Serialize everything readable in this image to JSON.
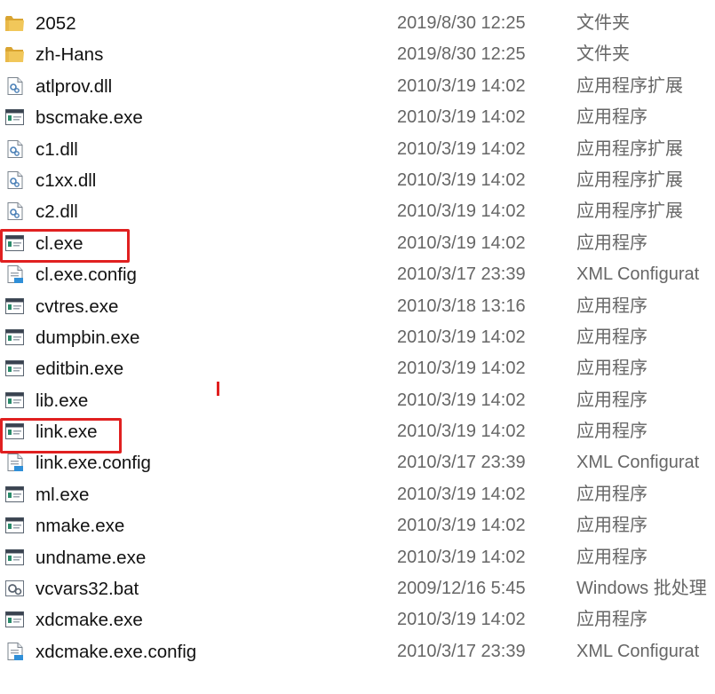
{
  "files": [
    {
      "name": "2052",
      "date": "2019/8/30 12:25",
      "type": "文件夹",
      "icon": "folder-icon"
    },
    {
      "name": "zh-Hans",
      "date": "2019/8/30 12:25",
      "type": "文件夹",
      "icon": "folder-icon"
    },
    {
      "name": "atlprov.dll",
      "date": "2010/3/19 14:02",
      "type": "应用程序扩展",
      "icon": "dll-icon"
    },
    {
      "name": "bscmake.exe",
      "date": "2010/3/19 14:02",
      "type": "应用程序",
      "icon": "exe-icon"
    },
    {
      "name": "c1.dll",
      "date": "2010/3/19 14:02",
      "type": "应用程序扩展",
      "icon": "dll-icon"
    },
    {
      "name": "c1xx.dll",
      "date": "2010/3/19 14:02",
      "type": "应用程序扩展",
      "icon": "dll-icon"
    },
    {
      "name": "c2.dll",
      "date": "2010/3/19 14:02",
      "type": "应用程序扩展",
      "icon": "dll-icon"
    },
    {
      "name": "cl.exe",
      "date": "2010/3/19 14:02",
      "type": "应用程序",
      "icon": "exe-icon",
      "highlighted": true
    },
    {
      "name": "cl.exe.config",
      "date": "2010/3/17 23:39",
      "type": "XML Configurat",
      "icon": "config-icon"
    },
    {
      "name": "cvtres.exe",
      "date": "2010/3/18 13:16",
      "type": "应用程序",
      "icon": "exe-icon"
    },
    {
      "name": "dumpbin.exe",
      "date": "2010/3/19 14:02",
      "type": "应用程序",
      "icon": "exe-icon"
    },
    {
      "name": "editbin.exe",
      "date": "2010/3/19 14:02",
      "type": "应用程序",
      "icon": "exe-icon"
    },
    {
      "name": "lib.exe",
      "date": "2010/3/19 14:02",
      "type": "应用程序",
      "icon": "exe-icon"
    },
    {
      "name": "link.exe",
      "date": "2010/3/19 14:02",
      "type": "应用程序",
      "icon": "exe-icon",
      "highlighted": true
    },
    {
      "name": "link.exe.config",
      "date": "2010/3/17 23:39",
      "type": "XML Configurat",
      "icon": "config-icon"
    },
    {
      "name": "ml.exe",
      "date": "2010/3/19 14:02",
      "type": "应用程序",
      "icon": "exe-icon"
    },
    {
      "name": "nmake.exe",
      "date": "2010/3/19 14:02",
      "type": "应用程序",
      "icon": "exe-icon"
    },
    {
      "name": "undname.exe",
      "date": "2010/3/19 14:02",
      "type": "应用程序",
      "icon": "exe-icon"
    },
    {
      "name": "vcvars32.bat",
      "date": "2009/12/16 5:45",
      "type": "Windows 批处理",
      "icon": "bat-icon"
    },
    {
      "name": "xdcmake.exe",
      "date": "2010/3/19 14:02",
      "type": "应用程序",
      "icon": "exe-icon"
    },
    {
      "name": "xdcmake.exe.config",
      "date": "2010/3/17 23:39",
      "type": "XML Configurat",
      "icon": "config-icon"
    }
  ],
  "colors": {
    "highlight": "#e02020",
    "folder": "#e9b949",
    "secondary_text": "#666666"
  }
}
